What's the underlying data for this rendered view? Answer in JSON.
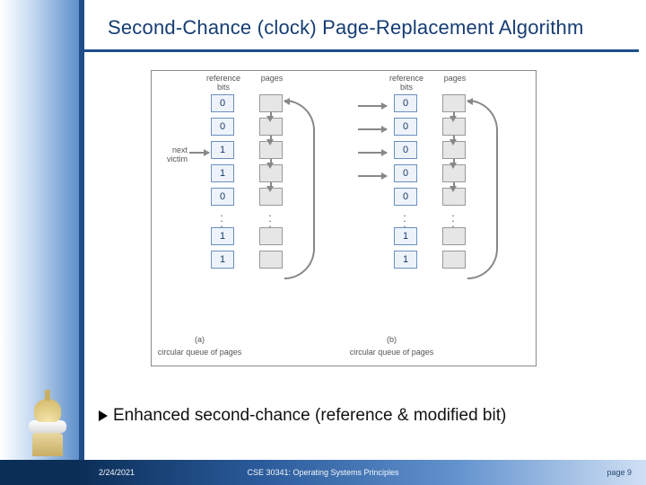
{
  "title": "Second-Chance (clock) Page-Replacement Algorithm",
  "bullet_text": "Enhanced second-chance (reference & modified bit)",
  "footer": {
    "date": "2/24/2021",
    "course": "CSE 30341: Operating Systems Principles",
    "page": "page 9"
  },
  "diagram": {
    "col_headers": {
      "bits": "reference\nbits",
      "pages": "pages"
    },
    "victim_label": "next\nvictim",
    "caption": "circular queue of pages",
    "sublabels": {
      "a": "(a)",
      "b": "(b)"
    },
    "queues": {
      "a": {
        "bits": [
          "0",
          "0",
          "1",
          "1",
          "0",
          "1",
          "1"
        ]
      },
      "b": {
        "bits": [
          "0",
          "0",
          "0",
          "0",
          "0",
          "1",
          "1"
        ]
      }
    }
  }
}
